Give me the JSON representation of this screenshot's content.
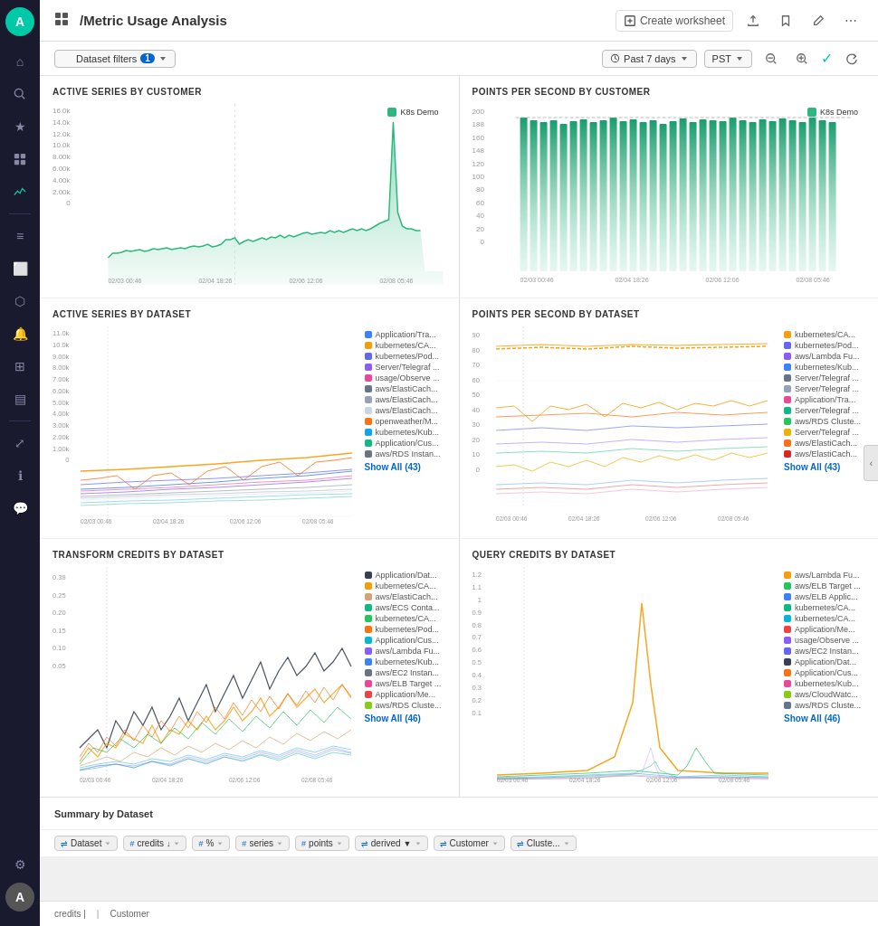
{
  "sidebar": {
    "logo": "A",
    "items": [
      {
        "name": "home",
        "icon": "⌂",
        "active": false
      },
      {
        "name": "search",
        "icon": "🔍",
        "active": false
      },
      {
        "name": "star",
        "icon": "★",
        "active": false
      },
      {
        "name": "chart-bar",
        "icon": "📊",
        "active": false
      },
      {
        "name": "analytics",
        "icon": "📈",
        "active": true
      },
      {
        "name": "layers",
        "icon": "≡",
        "active": false
      },
      {
        "name": "box",
        "icon": "⬜",
        "active": false
      },
      {
        "name": "network",
        "icon": "⬡",
        "active": false
      },
      {
        "name": "bell",
        "icon": "🔔",
        "active": false
      },
      {
        "name": "grid",
        "icon": "⊞",
        "active": false
      },
      {
        "name": "layout",
        "icon": "▤",
        "active": false
      },
      {
        "name": "share",
        "icon": "⤢",
        "active": false
      },
      {
        "name": "info",
        "icon": "ℹ",
        "active": false
      },
      {
        "name": "chat",
        "icon": "💬",
        "active": false
      },
      {
        "name": "settings",
        "icon": "⚙",
        "active": false
      }
    ]
  },
  "header": {
    "icon": "📊",
    "title": "/Metric Usage Analysis",
    "create_worksheet": "Create worksheet",
    "actions": [
      "upload",
      "bookmark",
      "edit",
      "more"
    ]
  },
  "toolbar": {
    "filter_label": "Dataset filters",
    "filter_count": "1",
    "time_range": "Past 7 days",
    "timezone": "PST",
    "zoom_in": "zoom-in",
    "zoom_out": "zoom-out",
    "status": "ok",
    "refresh": "refresh"
  },
  "charts": [
    {
      "id": "active-series-customer",
      "title": "ACTIVE SERIES BY CUSTOMER",
      "legend": [
        {
          "color": "#2db87d",
          "label": "K8s Demo"
        }
      ],
      "y_labels": [
        "16.0k",
        "14.0k",
        "12.0k",
        "10.0k",
        "8.00k",
        "6.00k",
        "4.00k",
        "2.00k",
        "0"
      ],
      "x_labels": [
        "02/03 00:46",
        "02/04 18:26",
        "02/06 12:06",
        "02/08 05:46"
      ]
    },
    {
      "id": "points-per-second-customer",
      "title": "POINTS PER SECOND BY CUSTOMER",
      "legend": [
        {
          "color": "#2db87d",
          "label": "K8s Demo"
        }
      ],
      "y_labels": [
        "200",
        "188",
        "160",
        "148",
        "120",
        "100",
        "80",
        "60",
        "40",
        "20",
        "0"
      ],
      "x_labels": [
        "02/03 00:46",
        "02/04 18:26",
        "02/06 12:06",
        "02/08 05:46"
      ]
    },
    {
      "id": "active-series-dataset",
      "title": "ACTIVE SERIES BY DATASET",
      "legend": [
        {
          "color": "#3b82f6",
          "label": "Application/Tra..."
        },
        {
          "color": "#f59e0b",
          "label": "kubernetes/CA..."
        },
        {
          "color": "#6366f1",
          "label": "kubernetes/Pod..."
        },
        {
          "color": "#8b5cf6",
          "label": "Server/Telegraf ..."
        },
        {
          "color": "#ec4899",
          "label": "usage/Observe ..."
        },
        {
          "color": "#64748b",
          "label": "aws/ElastiCach..."
        },
        {
          "color": "#94a3b8",
          "label": "aws/ElastiCach..."
        },
        {
          "color": "#cbd5e1",
          "label": "aws/ElastiCach..."
        },
        {
          "color": "#f97316",
          "label": "openweather/M..."
        },
        {
          "color": "#0ea5e9",
          "label": "kubernetes/Kub..."
        },
        {
          "color": "#10b981",
          "label": "Application/Cus..."
        },
        {
          "color": "#6b7280",
          "label": "aws/RDS Instan..."
        }
      ],
      "show_all": "Show All (43)",
      "y_labels": [
        "11.0k",
        "10.0k",
        "9.00k",
        "8.00k",
        "7.00k",
        "6.00k",
        "5.00k",
        "4.00k",
        "3.00k",
        "2.00k",
        "1.00k",
        "0"
      ],
      "x_labels": [
        "02/03 00:46",
        "02/04 18:26",
        "02/06 12:06",
        "02/08 05:46"
      ]
    },
    {
      "id": "points-per-second-dataset",
      "title": "POINTS PER SECOND BY DATASET",
      "legend": [
        {
          "color": "#f59e0b",
          "label": "kubernetes/CA..."
        },
        {
          "color": "#6366f1",
          "label": "kubernetes/Pod..."
        },
        {
          "color": "#8b5cf6",
          "label": "aws/Lambda Fu..."
        },
        {
          "color": "#3b82f6",
          "label": "kubernetes/Kub..."
        },
        {
          "color": "#64748b",
          "label": "Server/Telegraf ..."
        },
        {
          "color": "#94a3b8",
          "label": "Server/Telegraf ..."
        },
        {
          "color": "#ec4899",
          "label": "Application/Tra..."
        },
        {
          "color": "#10b981",
          "label": "Server/Telegraf ..."
        },
        {
          "color": "#22c55e",
          "label": "aws/RDS Cluste..."
        },
        {
          "color": "#eab308",
          "label": "Server/Telegraf ..."
        },
        {
          "color": "#f97316",
          "label": "aws/ElastiCach..."
        },
        {
          "color": "#dc2626",
          "label": "aws/ElastiCach..."
        }
      ],
      "show_all": "Show All (43)",
      "y_labels": [
        "90",
        "80",
        "70",
        "60",
        "50",
        "40",
        "30",
        "20",
        "10",
        "0"
      ],
      "x_labels": [
        "02/03 00:46",
        "02/04 18:26",
        "02/06 12:06",
        "02/08 05:46"
      ]
    },
    {
      "id": "transform-credits-dataset",
      "title": "TRANSFORM CREDITS BY DATASET",
      "legend": [
        {
          "color": "#374151",
          "label": "Application/Dat..."
        },
        {
          "color": "#f59e0b",
          "label": "kubernetes/CA..."
        },
        {
          "color": "#d4a574",
          "label": "aws/ElastiCach..."
        },
        {
          "color": "#10b981",
          "label": "aws/ECS Conta..."
        },
        {
          "color": "#22c55e",
          "label": "kubernetes/CA..."
        },
        {
          "color": "#f97316",
          "label": "kubernetes/Pod..."
        },
        {
          "color": "#06b6d4",
          "label": "Application/Cus..."
        },
        {
          "color": "#8b5cf6",
          "label": "aws/Lambda Fu..."
        },
        {
          "color": "#3b82f6",
          "label": "kubernetes/Kub..."
        },
        {
          "color": "#6b7280",
          "label": "aws/EC2 Instan..."
        },
        {
          "color": "#ec4899",
          "label": "aws/ELB Target ..."
        },
        {
          "color": "#ef4444",
          "label": "Application/Me..."
        },
        {
          "color": "#84cc16",
          "label": "aws/RDS Cluste..."
        }
      ],
      "show_all": "Show All (46)",
      "y_labels": [
        "0.38",
        "0.25",
        "0.20",
        "0.15",
        "0.10",
        "0.05"
      ],
      "x_labels": [
        "02/03 00:46",
        "02/04 18:26",
        "02/06 12:06",
        "02/08 05:46"
      ]
    },
    {
      "id": "query-credits-dataset",
      "title": "QUERY CREDITS BY DATASET",
      "legend": [
        {
          "color": "#f59e0b",
          "label": "aws/Lambda Fu..."
        },
        {
          "color": "#22c55e",
          "label": "aws/ELB Target ..."
        },
        {
          "color": "#3b82f6",
          "label": "aws/ELB Applic..."
        },
        {
          "color": "#10b981",
          "label": "kubernetes/CA..."
        },
        {
          "color": "#06b6d4",
          "label": "kubernetes/CA..."
        },
        {
          "color": "#ef4444",
          "label": "Application/Me..."
        },
        {
          "color": "#8b5cf6",
          "label": "usage/Observe ..."
        },
        {
          "color": "#6366f1",
          "label": "aws/EC2 Instan..."
        },
        {
          "color": "#374151",
          "label": "Application/Dat..."
        },
        {
          "color": "#f97316",
          "label": "Application/Cus..."
        },
        {
          "color": "#ec4899",
          "label": "kubernetes/Kub..."
        },
        {
          "color": "#84cc16",
          "label": "aws/CloudWatc..."
        },
        {
          "color": "#64748b",
          "label": "aws/RDS Cluste..."
        }
      ],
      "show_all": "Show All (46)",
      "y_labels": [
        "1.2",
        "1.1",
        "1",
        "0.9",
        "0.8",
        "0.7",
        "0.6",
        "0.5",
        "0.4",
        "0.3",
        "0.2",
        "0.1"
      ],
      "x_labels": [
        "02/03 00:46",
        "02/04 18:26",
        "02/06 12:06",
        "02/08 05:46"
      ]
    }
  ],
  "summary": {
    "title": "Summary by Dataset",
    "columns": [
      {
        "icon": "⇌",
        "label": "Dataset",
        "sort": false
      },
      {
        "icon": "#",
        "label": "credits",
        "sort": true,
        "dir": "↓"
      },
      {
        "icon": "#",
        "label": "%",
        "sort": false
      },
      {
        "icon": "#",
        "label": "series",
        "sort": false
      },
      {
        "icon": "#",
        "label": "points",
        "sort": false
      },
      {
        "icon": "⇌",
        "label": "derived",
        "sort": false,
        "extra": "▼"
      },
      {
        "icon": "⇌",
        "label": "Customer",
        "sort": false
      },
      {
        "icon": "⇌",
        "label": "Cluste...",
        "sort": false
      }
    ]
  },
  "footer": {
    "credits_label": "credits |",
    "customer_label": "Customer"
  }
}
